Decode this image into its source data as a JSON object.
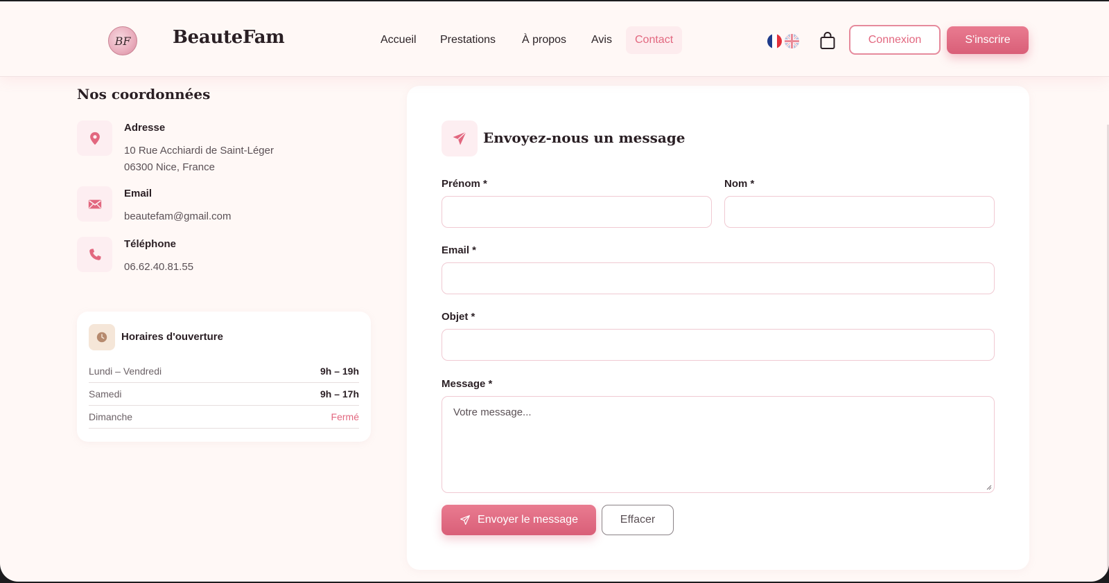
{
  "header": {
    "logo_text": "BF",
    "brand": "BeauteFam",
    "nav": [
      {
        "label": "Accueil",
        "active": false
      },
      {
        "label": "Prestations",
        "active": false
      },
      {
        "label": "À propos",
        "active": false
      },
      {
        "label": "Avis",
        "active": false
      },
      {
        "label": "Contact",
        "active": true
      }
    ],
    "languages": [
      "fr",
      "en"
    ],
    "cart_icon": "shopping-bag-icon",
    "login_label": "Connexion",
    "signup_label": "S'inscrire"
  },
  "contact": {
    "title": "Nos coordonnées",
    "items": [
      {
        "icon": "map-pin-icon",
        "label": "Adresse",
        "lines": [
          "10 Rue Acchiardi de Saint-Léger",
          "06300 Nice, France"
        ]
      },
      {
        "icon": "envelope-icon",
        "label": "Email",
        "lines": [
          "beautefam@gmail.com"
        ]
      },
      {
        "icon": "phone-icon",
        "label": "Téléphone",
        "lines": [
          "06.62.40.81.55"
        ]
      }
    ]
  },
  "hours": {
    "icon": "clock-icon",
    "title": "Horaires d'ouverture",
    "rows": [
      {
        "day": "Lundi – Vendredi",
        "time": "9h – 19h",
        "closed": false
      },
      {
        "day": "Samedi",
        "time": "9h – 17h",
        "closed": false
      },
      {
        "day": "Dimanche",
        "time": "Fermé",
        "closed": true
      }
    ]
  },
  "form": {
    "icon": "paper-plane-icon",
    "title": "Envoyez-nous un message",
    "fields": {
      "firstname": {
        "label": "Prénom *",
        "value": ""
      },
      "lastname": {
        "label": "Nom *",
        "value": ""
      },
      "email": {
        "label": "Email *",
        "value": ""
      },
      "subject": {
        "label": "Objet *",
        "value": ""
      },
      "message": {
        "label": "Message *",
        "placeholder": "Votre message...",
        "value": ""
      }
    },
    "send_label": "Envoyer le message",
    "clear_label": "Effacer"
  },
  "colors": {
    "accent": "#e2677f",
    "background": "#fff8f6",
    "icon_bg": "#fdeef1"
  }
}
